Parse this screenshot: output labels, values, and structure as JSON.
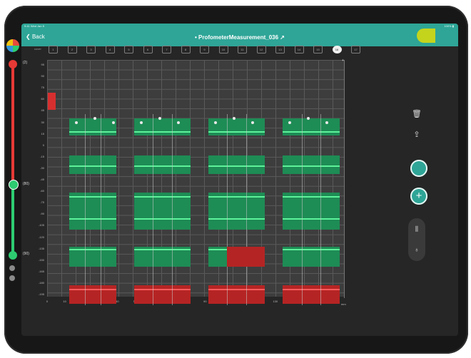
{
  "status_bar": {
    "time": "9:41 Wed Jan 5",
    "right": "100% ▮"
  },
  "nav": {
    "back_label": "Back",
    "title": "• ProfometerMeasurement_036 ↗"
  },
  "colors": {
    "accent": "#2ea597",
    "zone_ok": "#1e8c55",
    "zone_bad": "#b52424",
    "line": "#5df29a",
    "slider_top": "#e53935",
    "slider_bottom": "#2ecc71",
    "highlight": "#c4d41d"
  },
  "threshold_slider": {
    "labels": [
      "(2)",
      "(80)",
      "(90)"
    ],
    "top_color": "red",
    "bottom_color": "green"
  },
  "tabs": {
    "leading_label": "cover",
    "items": [
      "1",
      "2",
      "3",
      "4",
      "5",
      "6",
      "7",
      "8",
      "9",
      "10",
      "11",
      "12",
      "13",
      "14",
      "15",
      "16",
      "17"
    ],
    "active_index": 15
  },
  "chart": {
    "y_ticks": [
      "-195",
      "-180",
      "-165",
      "-150",
      "-135",
      "-120",
      "-105",
      "-90",
      "-75",
      "-60",
      "-45",
      "-30",
      "-15",
      "0",
      "15",
      "30",
      "45",
      "60",
      "75",
      "90",
      "95"
    ],
    "x_ticks": [
      "0",
      "10",
      "20",
      "30",
      "40",
      "50",
      "60",
      "70",
      "80",
      "90",
      "100",
      "110",
      "120",
      "130",
      "140",
      "150",
      "160"
    ],
    "x_unit": "mm",
    "right_axis_marker": "+"
  },
  "sidebar": {
    "icons": [
      "trash-icon",
      "share-icon",
      "record-icon",
      "add-icon",
      "columns-icon",
      "mic-icon"
    ]
  }
}
